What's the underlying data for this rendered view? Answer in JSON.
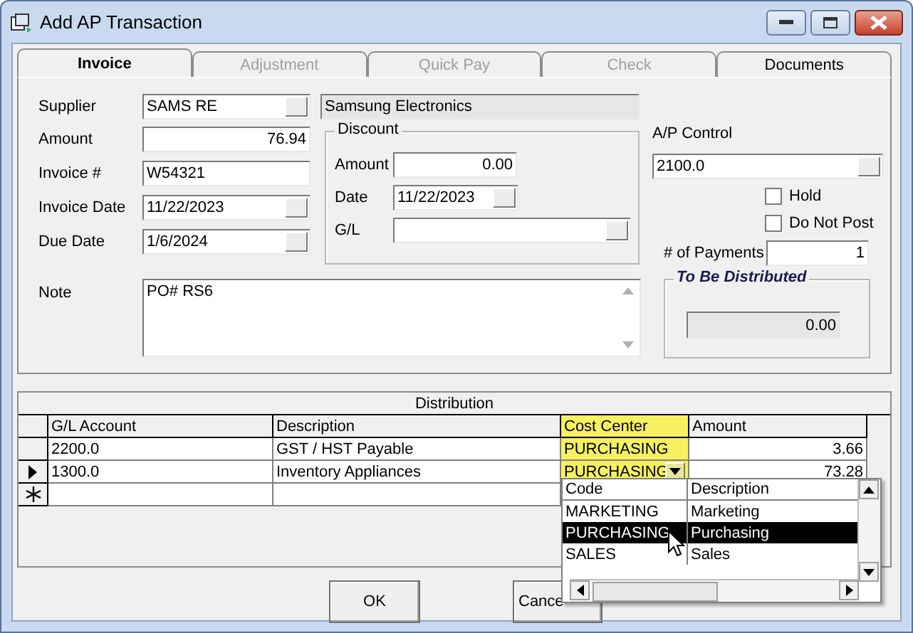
{
  "window": {
    "title": "Add AP Transaction"
  },
  "tabs": [
    {
      "label": "Invoice",
      "selected": true,
      "disabled": false
    },
    {
      "label": "Adjustment",
      "selected": false,
      "disabled": true
    },
    {
      "label": "Quick Pay",
      "selected": false,
      "disabled": true
    },
    {
      "label": "Check",
      "selected": false,
      "disabled": true
    },
    {
      "label": "Documents",
      "selected": false,
      "disabled": false
    }
  ],
  "supplier": {
    "label": "Supplier",
    "value": "SAMS RE",
    "name": "Samsung Electronics"
  },
  "fields": [
    {
      "label": "Amount",
      "value": "76.94",
      "kind": "number"
    },
    {
      "label": "Invoice #",
      "value": "W54321",
      "kind": "text"
    },
    {
      "label": "Invoice Date",
      "value": "11/22/2023",
      "kind": "combo"
    },
    {
      "label": "Due Date",
      "value": "1/6/2024",
      "kind": "combo"
    }
  ],
  "discount": {
    "title": "Discount",
    "fields": [
      {
        "label": "Amount",
        "value": "0.00",
        "kind": "number"
      },
      {
        "label": "Date",
        "value": "11/22/2023",
        "kind": "combo"
      },
      {
        "label": "G/L",
        "kind": "combo"
      }
    ]
  },
  "note": {
    "label": "Note",
    "value": "PO# RS6"
  },
  "ap_control": {
    "label": "A/P Control",
    "value": "2100.0"
  },
  "checkboxes": [
    {
      "label": "Hold",
      "checked": false
    },
    {
      "label": "Do Not Post",
      "checked": false
    }
  ],
  "payments": {
    "label": "# of Payments",
    "value": "1"
  },
  "to_be_distributed": {
    "title": "To Be Distributed",
    "value": "0.00"
  },
  "distribution": {
    "title": "Distribution",
    "columns": [
      {
        "label": "G/L Account",
        "highlighted": false
      },
      {
        "label": "Description",
        "highlighted": false
      },
      {
        "label": "Cost Center",
        "highlighted": true
      },
      {
        "label": "Amount",
        "highlighted": false
      }
    ],
    "rows": [
      {
        "gl_account": "2200.0",
        "description": "GST / HST Payable",
        "cost_center": "PURCHASING",
        "amount": "3.66",
        "current": false
      },
      {
        "gl_account": "1300.0",
        "description": "Inventory Appliances",
        "cost_center": "PURCHASING",
        "amount": "73.28",
        "current": true
      }
    ],
    "new_row": true
  },
  "dropdown": {
    "columns": [
      "Code",
      "Description"
    ],
    "items": [
      {
        "code": "MARKETING",
        "description": "Marketing",
        "selected": false
      },
      {
        "code": "PURCHASING",
        "description": "Purchasing",
        "selected": true
      },
      {
        "code": "SALES",
        "description": "Sales",
        "selected": false
      }
    ]
  },
  "buttons": [
    {
      "label": "OK"
    },
    {
      "label": "Cance"
    }
  ]
}
